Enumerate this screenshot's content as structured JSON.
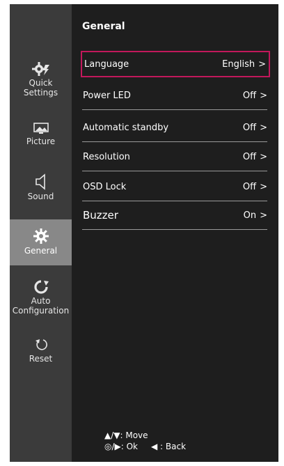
{
  "menu": {
    "title": "General",
    "sidebar": [
      {
        "label_line1": "Quick",
        "label_line2": "Settings",
        "icon": "gear-lightning-icon"
      },
      {
        "label_line1": "Picture",
        "icon": "picture-icon"
      },
      {
        "label_line1": "Sound",
        "icon": "speaker-icon"
      },
      {
        "label_line1": "General",
        "icon": "gear-icon"
      },
      {
        "label_line1": "Auto",
        "label_line2": "Configuration",
        "icon": "auto-config-icon"
      },
      {
        "label_line1": "Reset",
        "icon": "reset-icon"
      }
    ],
    "items": [
      {
        "label": "Language",
        "value": "English"
      },
      {
        "label": "Power LED",
        "value": "Off"
      },
      {
        "label": "Automatic standby",
        "value": "Off"
      },
      {
        "label": "Resolution",
        "value": "Off"
      },
      {
        "label": "OSD Lock",
        "value": "Off"
      },
      {
        "label": "Buzzer",
        "value": "On"
      }
    ],
    "chevron": ">",
    "hints": {
      "move": "▲/▼: Move",
      "ok": "◎/▶: Ok",
      "back": "◀ : Back"
    }
  },
  "colors": {
    "highlight_border": "#c2185b",
    "active_nav": "#888888"
  }
}
